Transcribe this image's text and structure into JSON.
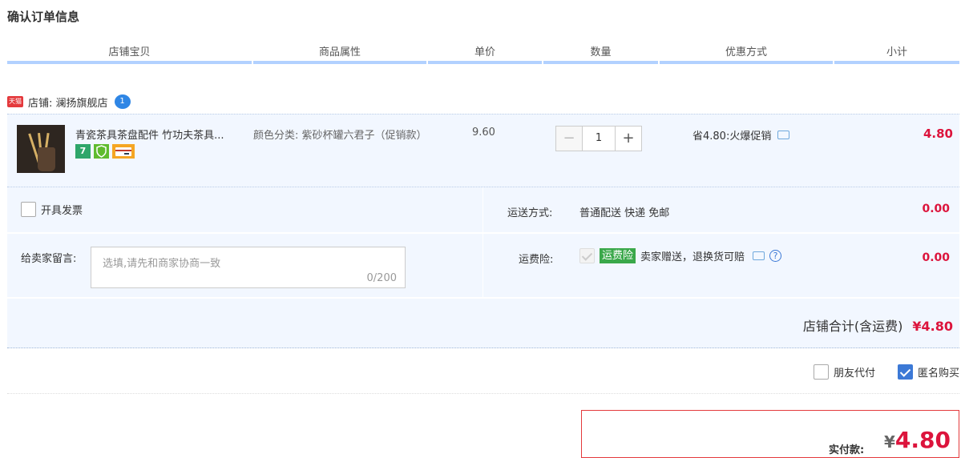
{
  "page_title": "确认订单信息",
  "table_header": {
    "columns": [
      "店铺宝贝",
      "商品属性",
      "单价",
      "数量",
      "优惠方式",
      "小计"
    ]
  },
  "shop": {
    "tmall_badge": "天猫",
    "label": "店铺: 澜扬旗舰店",
    "chat_badge": "1"
  },
  "item": {
    "name": "青瓷茶具茶盘配件 竹功夫茶具...",
    "badges": [
      "7",
      "shield-icon",
      "card-icon"
    ],
    "attribute": "颜色分类: 紫砂杯罐六君子（促销款）",
    "unit_price": "9.60",
    "quantity": "1",
    "minus": "−",
    "plus": "+",
    "promo": "省4.80:火爆促销",
    "subtotal": "4.80"
  },
  "options": {
    "invoice_label": "开具发票",
    "shipping_label": "运送方式:",
    "shipping_value": "普通配送 快递 免邮",
    "shipping_cost": "0.00",
    "memo_label": "给卖家留言:",
    "memo_placeholder": "选填,请先和商家协商一致",
    "memo_counter": "0/200",
    "insurance_label": "运费险:",
    "insurance_tag": "运费险",
    "insurance_text": "卖家赠送，退换货可赔",
    "insurance_cost": "0.00"
  },
  "shop_total": {
    "label": "店铺合计(含运费)",
    "value": "¥4.80"
  },
  "extras": {
    "friend_pay": "朋友代付",
    "anonymous": "匿名购买",
    "anonymous_checked": true
  },
  "payment": {
    "label": "实付款:",
    "currency": "¥",
    "amount": "4.80"
  },
  "colors": {
    "accent_red": "#dc143c",
    "header_bar": "#b2d1ff",
    "row_bg": "#f2f7ff",
    "check_blue": "#3c79d6"
  }
}
